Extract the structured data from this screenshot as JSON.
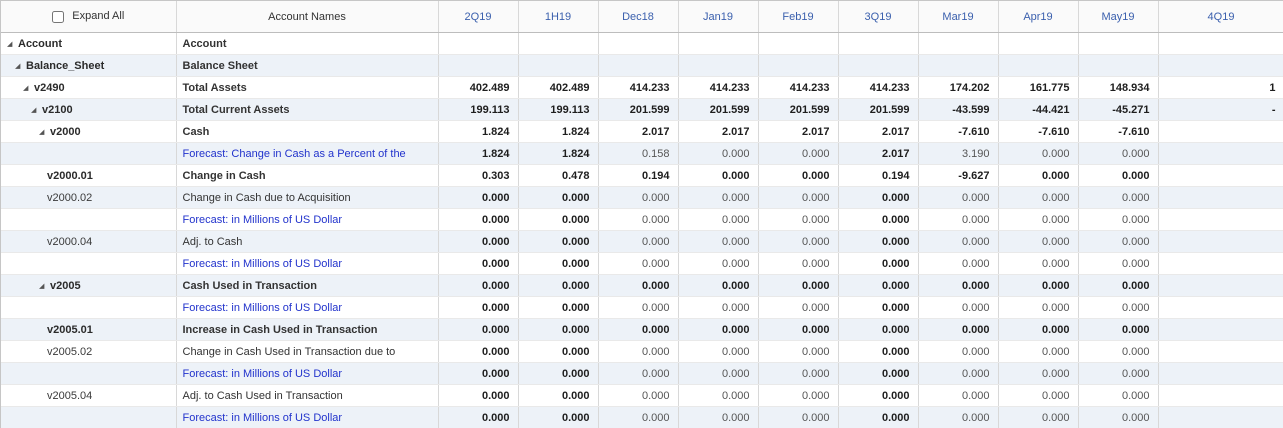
{
  "colors": {
    "header_bg": "#fafafa",
    "header_period_text": "#3a5fad",
    "forecast_text": "#2233cc",
    "row_shaded_bg": "#edf2f8",
    "vertical_border": "#d8d8d8",
    "horizontal_border": "#e9e9e9",
    "value_normal": "#555555",
    "value_bold": "#1e1e1e"
  },
  "header": {
    "expand_all_label": "Expand All",
    "account_names_label": "Account Names",
    "periods": [
      "2Q19",
      "1H19",
      "Dec18",
      "Jan19",
      "Feb19",
      "3Q19",
      "Mar19",
      "Apr19",
      "May19",
      "4Q19"
    ]
  },
  "bold_value_columns": [
    0,
    1,
    5
  ],
  "rows": [
    {
      "id": "Account",
      "name": "Account",
      "level": 0,
      "expandable": true,
      "bold": true,
      "forecast": false,
      "values": [
        "",
        "",
        "",
        "",
        "",
        "",
        "",
        "",
        "",
        ""
      ]
    },
    {
      "id": "Balance_Sheet",
      "name": "Balance Sheet",
      "level": 1,
      "expandable": true,
      "bold": true,
      "forecast": false,
      "values": [
        "",
        "",
        "",
        "",
        "",
        "",
        "",
        "",
        "",
        ""
      ]
    },
    {
      "id": "v2490",
      "name": "Total Assets",
      "level": 2,
      "expandable": true,
      "bold": true,
      "forecast": false,
      "values": [
        "402.489",
        "402.489",
        "414.233",
        "414.233",
        "414.233",
        "414.233",
        "174.202",
        "161.775",
        "148.934",
        "1"
      ]
    },
    {
      "id": "v2100",
      "name": "Total Current Assets",
      "level": 3,
      "expandable": true,
      "bold": true,
      "forecast": false,
      "values": [
        "199.113",
        "199.113",
        "201.599",
        "201.599",
        "201.599",
        "201.599",
        "-43.599",
        "-44.421",
        "-45.271",
        "-"
      ]
    },
    {
      "id": "v2000",
      "name": "Cash",
      "level": 4,
      "expandable": true,
      "bold": true,
      "forecast": false,
      "values": [
        "1.824",
        "1.824",
        "2.017",
        "2.017",
        "2.017",
        "2.017",
        "-7.610",
        "-7.610",
        "-7.610",
        ""
      ]
    },
    {
      "id": "",
      "name": "Forecast: Change in Cash as a Percent of the",
      "level": 5,
      "expandable": false,
      "bold": false,
      "forecast": true,
      "values": [
        "1.824",
        "1.824",
        "0.158",
        "0.000",
        "0.000",
        "2.017",
        "3.190",
        "0.000",
        "0.000",
        ""
      ]
    },
    {
      "id": "v2000.01",
      "name": "Change in Cash",
      "level": 5,
      "expandable": false,
      "bold": true,
      "forecast": false,
      "values": [
        "0.303",
        "0.478",
        "0.194",
        "0.000",
        "0.000",
        "0.194",
        "-9.627",
        "0.000",
        "0.000",
        ""
      ]
    },
    {
      "id": "v2000.02",
      "name": "Change in Cash due to Acquisition",
      "level": 5,
      "expandable": false,
      "bold": false,
      "forecast": false,
      "values": [
        "0.000",
        "0.000",
        "0.000",
        "0.000",
        "0.000",
        "0.000",
        "0.000",
        "0.000",
        "0.000",
        ""
      ]
    },
    {
      "id": "",
      "name": "Forecast: in Millions of US Dollar",
      "level": 5,
      "expandable": false,
      "bold": false,
      "forecast": true,
      "values": [
        "0.000",
        "0.000",
        "0.000",
        "0.000",
        "0.000",
        "0.000",
        "0.000",
        "0.000",
        "0.000",
        ""
      ]
    },
    {
      "id": "v2000.04",
      "name": "Adj. to Cash",
      "level": 5,
      "expandable": false,
      "bold": false,
      "forecast": false,
      "values": [
        "0.000",
        "0.000",
        "0.000",
        "0.000",
        "0.000",
        "0.000",
        "0.000",
        "0.000",
        "0.000",
        ""
      ]
    },
    {
      "id": "",
      "name": "Forecast: in Millions of US Dollar",
      "level": 5,
      "expandable": false,
      "bold": false,
      "forecast": true,
      "values": [
        "0.000",
        "0.000",
        "0.000",
        "0.000",
        "0.000",
        "0.000",
        "0.000",
        "0.000",
        "0.000",
        ""
      ]
    },
    {
      "id": "v2005",
      "name": "Cash Used in Transaction",
      "level": 4,
      "expandable": true,
      "bold": true,
      "forecast": false,
      "values": [
        "0.000",
        "0.000",
        "0.000",
        "0.000",
        "0.000",
        "0.000",
        "0.000",
        "0.000",
        "0.000",
        ""
      ]
    },
    {
      "id": "",
      "name": "Forecast: in Millions of US Dollar",
      "level": 5,
      "expandable": false,
      "bold": false,
      "forecast": true,
      "values": [
        "0.000",
        "0.000",
        "0.000",
        "0.000",
        "0.000",
        "0.000",
        "0.000",
        "0.000",
        "0.000",
        ""
      ]
    },
    {
      "id": "v2005.01",
      "name": "Increase in Cash Used in Transaction",
      "level": 5,
      "expandable": false,
      "bold": true,
      "forecast": false,
      "values": [
        "0.000",
        "0.000",
        "0.000",
        "0.000",
        "0.000",
        "0.000",
        "0.000",
        "0.000",
        "0.000",
        ""
      ]
    },
    {
      "id": "v2005.02",
      "name": "Change in Cash Used in Transaction due to",
      "level": 5,
      "expandable": false,
      "bold": false,
      "forecast": false,
      "values": [
        "0.000",
        "0.000",
        "0.000",
        "0.000",
        "0.000",
        "0.000",
        "0.000",
        "0.000",
        "0.000",
        ""
      ]
    },
    {
      "id": "",
      "name": "Forecast: in Millions of US Dollar",
      "level": 5,
      "expandable": false,
      "bold": false,
      "forecast": true,
      "values": [
        "0.000",
        "0.000",
        "0.000",
        "0.000",
        "0.000",
        "0.000",
        "0.000",
        "0.000",
        "0.000",
        ""
      ]
    },
    {
      "id": "v2005.04",
      "name": "Adj. to Cash Used in Transaction",
      "level": 5,
      "expandable": false,
      "bold": false,
      "forecast": false,
      "values": [
        "0.000",
        "0.000",
        "0.000",
        "0.000",
        "0.000",
        "0.000",
        "0.000",
        "0.000",
        "0.000",
        ""
      ]
    },
    {
      "id": "",
      "name": "Forecast: in Millions of US Dollar",
      "level": 5,
      "expandable": false,
      "bold": false,
      "forecast": true,
      "values": [
        "0.000",
        "0.000",
        "0.000",
        "0.000",
        "0.000",
        "0.000",
        "0.000",
        "0.000",
        "0.000",
        ""
      ]
    }
  ]
}
